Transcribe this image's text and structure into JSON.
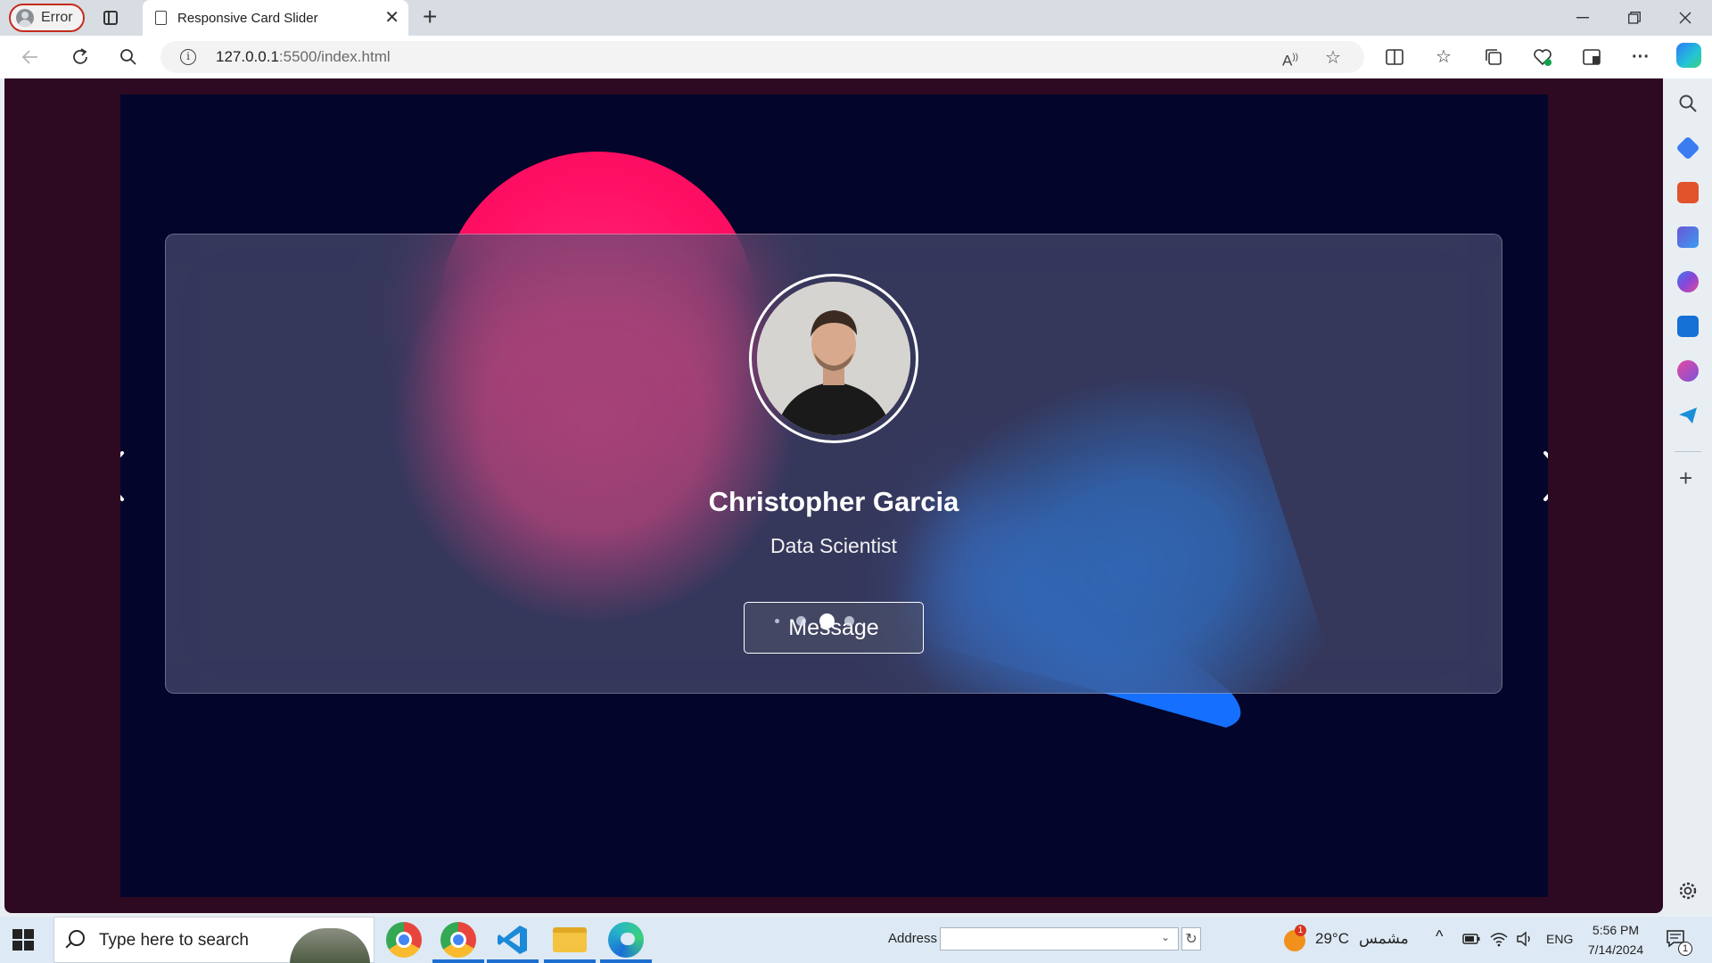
{
  "browser": {
    "profile_label": "Error",
    "tab_title": "Responsive Card Slider",
    "url_host": "127.0.0.1",
    "url_rest": ":5500/index.html"
  },
  "page": {
    "card": {
      "name": "Christopher Garcia",
      "role": "Data Scientist",
      "button_label": "Message"
    },
    "pagination": {
      "total": 4,
      "active_index": 2
    },
    "colors": {
      "viewport_bg": "#2e0a22",
      "stage_bg": "#03052a",
      "circle_blob": "#ff0f63",
      "triangle_blob": "#1a73ff"
    }
  },
  "taskbar": {
    "search_placeholder": "Type here to search",
    "address_label": "Address",
    "weather_temp": "29°C",
    "weather_desc": "مشمس",
    "weather_badge": "1",
    "language": "ENG",
    "time": "5:56 PM",
    "date": "7/14/2024",
    "notification_count": "1"
  }
}
